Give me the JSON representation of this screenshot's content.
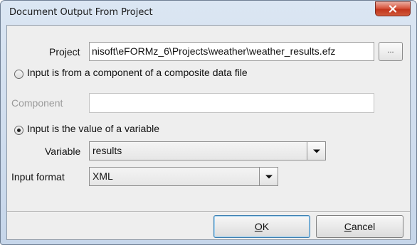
{
  "window": {
    "title": "Document Output From Project"
  },
  "project": {
    "label": "Project",
    "value": "nisoft\\eFORMz_6\\Projects\\weather\\weather_results.efz",
    "browse_label": "..."
  },
  "options": {
    "component_option": {
      "label": "Input is from a component of a composite data file",
      "selected": false
    },
    "component": {
      "label": "Component",
      "value": ""
    },
    "variable_option": {
      "label": "Input is the value of a variable",
      "selected": true
    },
    "variable": {
      "label": "Variable",
      "selected_value": "results"
    },
    "input_format": {
      "label": "Input format",
      "selected_value": "XML"
    }
  },
  "buttons": {
    "ok": {
      "mnemonic": "O",
      "rest": "K"
    },
    "cancel": {
      "mnemonic": "C",
      "rest": "ancel"
    }
  },
  "icons": {
    "close": "close-x-icon",
    "combo_arrow": "chevron-down-icon"
  }
}
